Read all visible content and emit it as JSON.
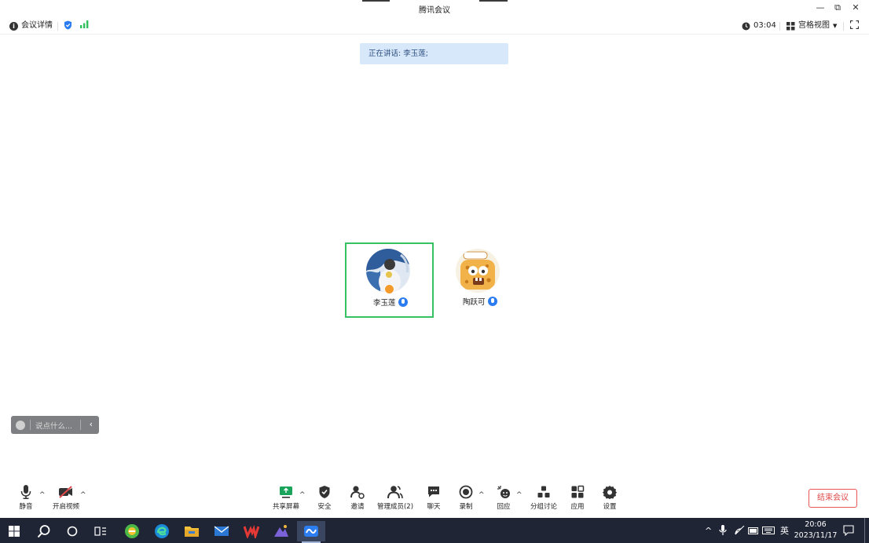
{
  "window": {
    "title": "腾讯会议"
  },
  "infobar": {
    "meeting_details": "会议详情",
    "timer": "03:04",
    "view_mode": "宫格视图"
  },
  "banner": {
    "speaking": "正在讲话: 李玉莲;"
  },
  "participants": [
    {
      "name": "李玉莲",
      "active": true,
      "host": true
    },
    {
      "name": "陶跃可",
      "active": false,
      "host": false
    }
  ],
  "chat": {
    "placeholder": "说点什么..."
  },
  "toolbar": {
    "mute": "静音",
    "video": "开启视频",
    "share": "共享屏幕",
    "security": "安全",
    "invite": "邀请",
    "members": "管理成员(2)",
    "chat": "聊天",
    "record": "录制",
    "react": "回应",
    "breakout": "分组讨论",
    "apps": "应用",
    "settings": "设置",
    "end": "结束会议"
  },
  "taskbar": {
    "ime": "英",
    "time": "20:06",
    "date": "2023/11/17"
  },
  "colors": {
    "accent": "#2a7cf0",
    "active_border": "#36c162",
    "end_red": "#e04a4a",
    "taskbar_bg": "#1f2535",
    "banner_bg": "#d8e8fb"
  }
}
